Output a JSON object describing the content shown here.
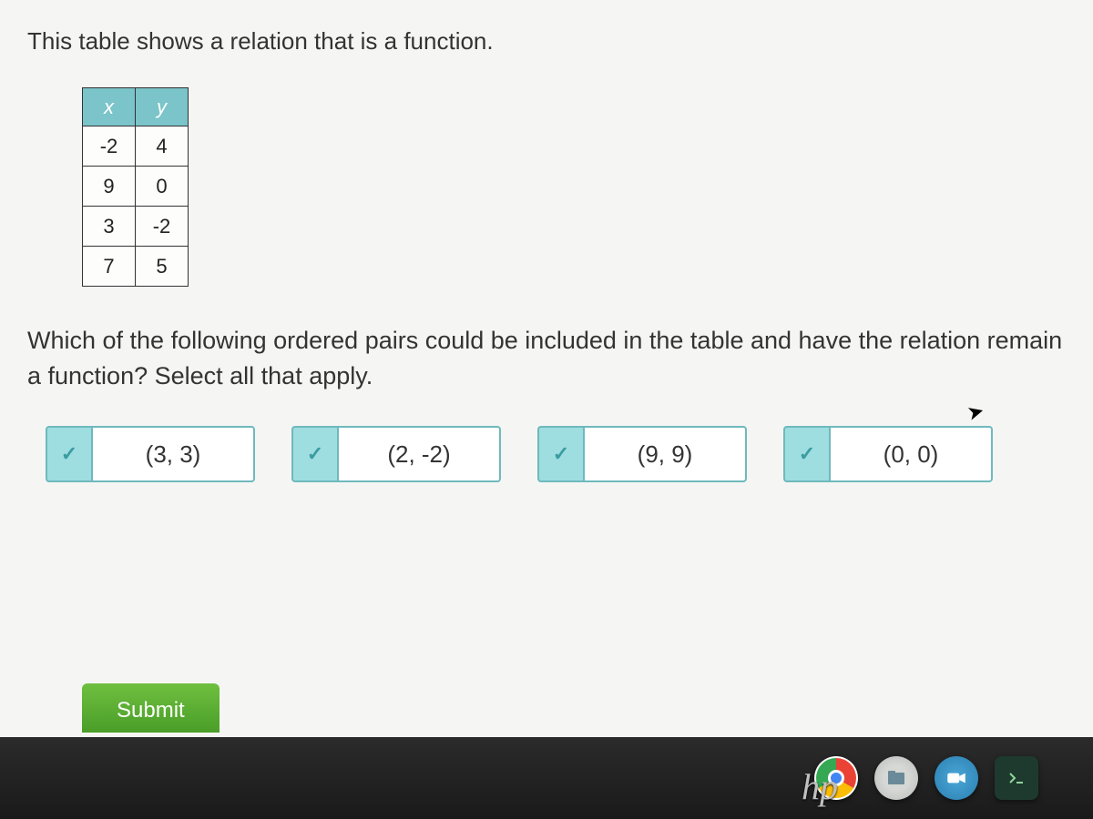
{
  "intro": "This table shows a relation that is a function.",
  "table": {
    "headers": {
      "x": "x",
      "y": "y"
    },
    "rows": [
      {
        "x": "-2",
        "y": "4"
      },
      {
        "x": "9",
        "y": "0"
      },
      {
        "x": "3",
        "y": "-2"
      },
      {
        "x": "7",
        "y": "5"
      }
    ]
  },
  "question": "Which of the following ordered pairs could be included in the table and have the relation remain a function? Select all that apply.",
  "options": [
    {
      "label": "(3, 3)",
      "checked": true
    },
    {
      "label": "(2, -2)",
      "checked": true
    },
    {
      "label": "(9, 9)",
      "checked": true
    },
    {
      "label": "(0, 0)",
      "checked": true
    }
  ],
  "submit_label": "Submit",
  "checkmark_glyph": "✓",
  "brand": "hp",
  "taskbar": {
    "chrome": "Chrome",
    "files": "Files",
    "video": "Video",
    "terminal": "Terminal"
  }
}
